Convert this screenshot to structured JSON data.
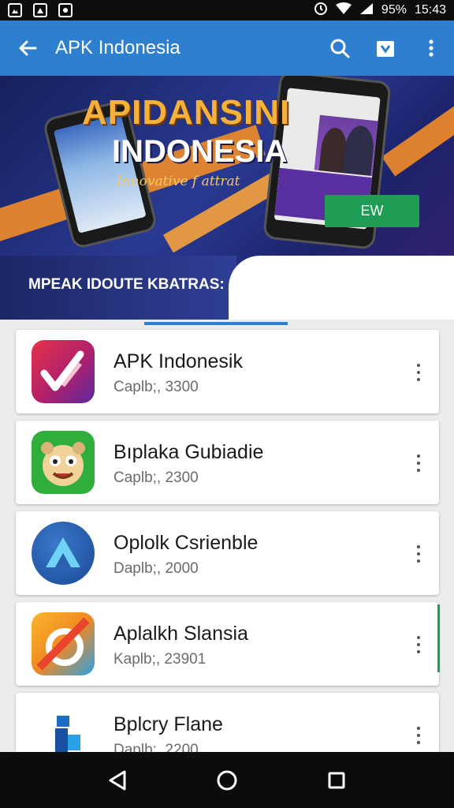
{
  "status_bar": {
    "battery": "95%",
    "time": "15:43"
  },
  "app_bar": {
    "title": "APK Indonesia"
  },
  "banner": {
    "title_line1": "APIDANSINI",
    "title_line2": "INDONESIA",
    "tagline": "Innovative f attrat",
    "subtitle": "MPEAK IDOUTE KBATRAS:",
    "button_label": "EW"
  },
  "apps": [
    {
      "name": "APK Indonesik",
      "subtitle": "Caplb;, 3300",
      "icon": "checkmark-app-icon"
    },
    {
      "name": "Bıplaka Gubiadie",
      "subtitle": "Caplb;, 2300",
      "icon": "cartoon-face-app-icon"
    },
    {
      "name": "Oplolk Csrienble",
      "subtitle": "Daplb;, 2000",
      "icon": "arrow-app-icon"
    },
    {
      "name": "Aplalkh Slansia",
      "subtitle": "Kaplb;, 23901",
      "icon": "slash-app-icon"
    },
    {
      "name": "Bplcry Flane",
      "subtitle": "Daplb;, 2200",
      "icon": "blocks-app-icon"
    }
  ],
  "colors": {
    "app_bar": "#2f7fcf",
    "button": "#1f9d55",
    "status_bar": "#0d0d0d"
  }
}
